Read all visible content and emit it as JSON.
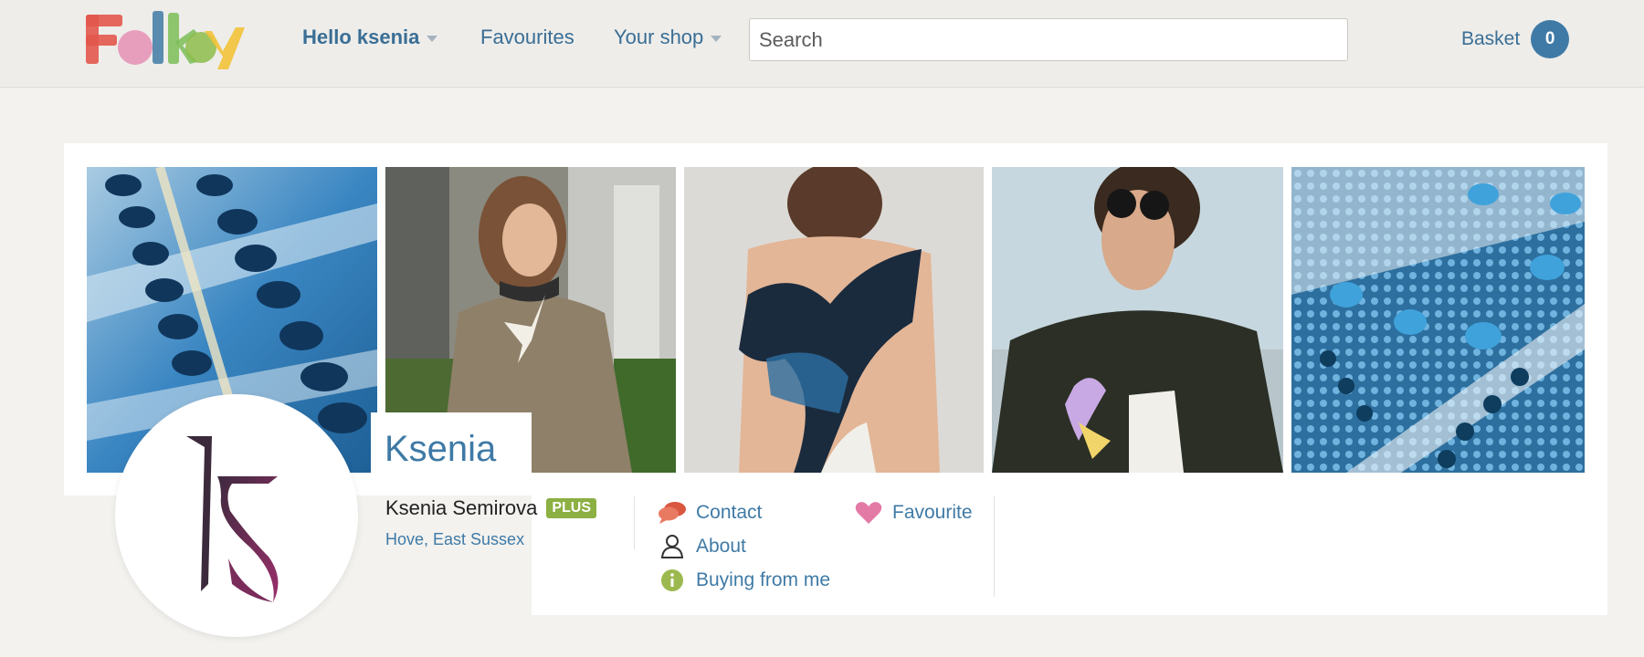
{
  "header": {
    "logo_text": "Folksy",
    "nav": {
      "user_label": "Hello ksenia",
      "favourites_label": "Favourites",
      "shop_label": "Your shop"
    },
    "search": {
      "placeholder": "Search",
      "value": ""
    },
    "basket": {
      "label": "Basket",
      "count": "0"
    }
  },
  "shop": {
    "name": "Ksenia",
    "owner": "Ksenia Semirova",
    "badge": "PLUS",
    "location": "Hove, East Sussex",
    "avatar_monogram": "ks",
    "actions": {
      "contact": "Contact",
      "favourite": "Favourite",
      "about": "About",
      "buying": "Buying from me"
    }
  },
  "banner_images": [
    "beaded-embroidery-closeup",
    "woman-in-sweater-with-bird-brooch",
    "embroidered-dress-back",
    "woman-in-sunglasses-with-bird-brooch",
    "blue-beadwork-closeup"
  ],
  "colors": {
    "accent": "#3f7aa6",
    "link": "#3a6e95",
    "plus_badge": "#8cb043",
    "favourite_heart": "#e37aa6",
    "contact_icon": "#d9563f",
    "info_icon": "#9bb94e"
  },
  "icons": {
    "contact": "speech-bubbles-icon",
    "favourite": "heart-icon",
    "about": "person-icon",
    "buying": "info-icon"
  }
}
